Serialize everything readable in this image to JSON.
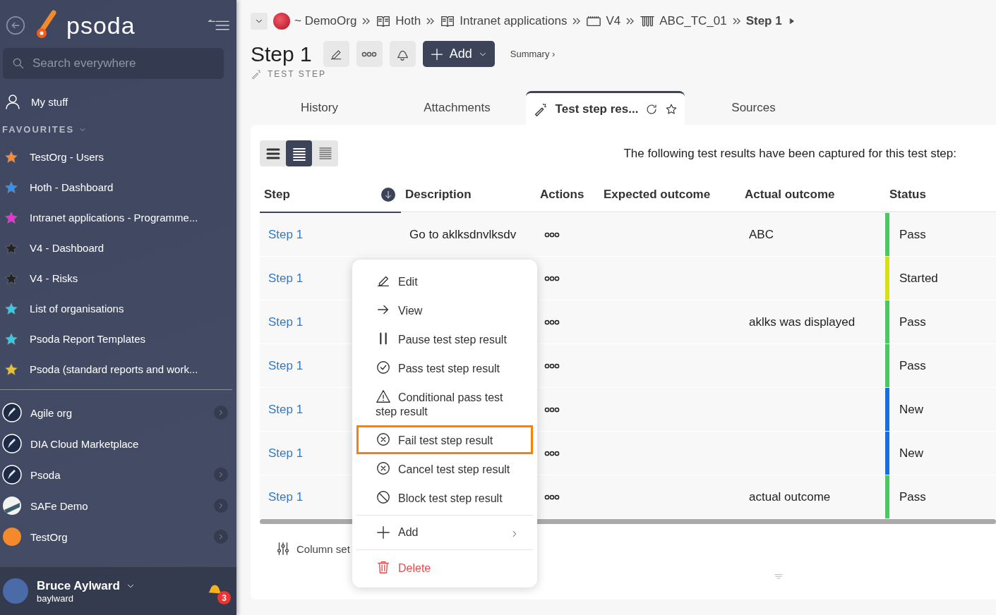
{
  "sidebar": {
    "app_name": "psoda",
    "search": {
      "placeholder": "Search everywhere"
    },
    "my_stuff": "My stuff",
    "favourites_heading": "FAVOURITES",
    "favourites": [
      {
        "label": "TestOrg - Users",
        "color": "#f58a3c"
      },
      {
        "label": "Hoth - Dashboard",
        "color": "#3a8fe6"
      },
      {
        "label": "Intranet applications - Programme...",
        "color": "#e633d6"
      },
      {
        "label": "V4 - Dashboard",
        "color": "#222222"
      },
      {
        "label": "V4 - Risks",
        "color": "#222222"
      },
      {
        "label": "List of organisations",
        "color": "#3cc8e0"
      },
      {
        "label": "Psoda Report Templates",
        "color": "#3cc8e0"
      },
      {
        "label": "Psoda (standard reports and work...",
        "color": "#e8c030"
      }
    ],
    "organisations": [
      {
        "label": "Agile org",
        "kind": "rocket",
        "expandable": true
      },
      {
        "label": "DIA Cloud Marketplace",
        "kind": "rocket",
        "expandable": false
      },
      {
        "label": "Psoda",
        "kind": "rocket",
        "expandable": true
      },
      {
        "label": "SAFe Demo",
        "kind": "stripes",
        "expandable": true
      },
      {
        "label": "TestOrg",
        "kind": "sun",
        "expandable": true
      }
    ],
    "user": {
      "name": "Bruce Aylward",
      "username": "baylward",
      "notifications": "3"
    }
  },
  "breadcrumbs": [
    {
      "label": "~ DemoOrg",
      "kind": "org"
    },
    {
      "label": "Hoth",
      "kind": "book"
    },
    {
      "label": "Intranet applications",
      "kind": "book"
    },
    {
      "label": "V4",
      "kind": "case"
    },
    {
      "label": "ABC_TC_01",
      "kind": "tubes"
    },
    {
      "label": "Step 1",
      "kind": "current"
    }
  ],
  "header": {
    "title": "Step 1",
    "subtitle": "TEST STEP",
    "add_button": "Add",
    "summary_link": "Summary ›"
  },
  "tabs": [
    {
      "label": "History",
      "selected": false
    },
    {
      "label": "Attachments",
      "selected": false
    },
    {
      "label": "Test step res...",
      "selected": true
    },
    {
      "label": "Sources",
      "selected": false
    }
  ],
  "view_modes": [
    {
      "selected": false
    },
    {
      "selected": true
    },
    {
      "selected": false
    }
  ],
  "intro": "The following test results have been captured for this test step:",
  "table": {
    "columns": [
      "Step",
      "Description",
      "Actions",
      "Expected outcome",
      "Actual outcome",
      "Status"
    ],
    "rows": [
      {
        "step": "Step 1",
        "description": "Go to aklksdnvlksdv",
        "actual": "ABC",
        "status": "Pass",
        "color": "#4cc764"
      },
      {
        "step": "Step 1",
        "status": "Started",
        "color": "#d6df1a"
      },
      {
        "step": "Step 1",
        "actual": "aklks was displayed",
        "status": "Pass",
        "color": "#4cc764"
      },
      {
        "step": "Step 1",
        "status": "Pass",
        "color": "#4cc764"
      },
      {
        "step": "Step 1",
        "status": "New",
        "color": "#1a6fe0"
      },
      {
        "step": "Step 1",
        "status": "New",
        "color": "#1a6fe0"
      },
      {
        "step": "Step 1",
        "actual": "actual outcome",
        "status": "Pass",
        "color": "#4cc764"
      }
    ]
  },
  "column_settings": "Column set",
  "context_menu": [
    {
      "label": "Edit",
      "kind": "edit",
      "highlighted": false
    },
    {
      "label": "View",
      "kind": "view",
      "highlighted": false
    },
    {
      "label": "Pause test step result",
      "kind": "pause",
      "highlighted": false
    },
    {
      "label": "Pass test step result",
      "kind": "pass",
      "highlighted": false
    },
    {
      "label": "Conditional pass test step result",
      "kind": "warning",
      "highlighted": false
    },
    {
      "label": "Fail test step result",
      "kind": "fail",
      "highlighted": true
    },
    {
      "label": "Cancel test step result",
      "kind": "cancel",
      "highlighted": false
    },
    {
      "label": "Block test step result",
      "kind": "block",
      "highlighted": false
    },
    {
      "label": "Add",
      "kind": "submenu",
      "highlighted": false
    },
    {
      "label": "Delete",
      "kind": "delete",
      "highlighted": false
    }
  ]
}
